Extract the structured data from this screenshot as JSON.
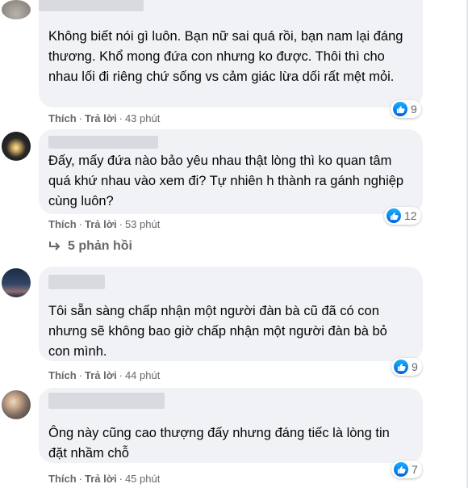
{
  "comments": [
    {
      "text": "Không biết nói gì luôn. Bạn nữ sai quá rồi, bạn nam lại đáng thương. Khổ mong đứa con nhưng ko được. Thôi thì cho nhau lối đi riêng chứ sống vs cảm giác lừa dối rất mệt mỏi.",
      "like_label": "Thích",
      "reply_label": "Trả lời",
      "time": "43 phút",
      "reaction_count": "9"
    },
    {
      "text": "Đấy, mấy đứa nào bảo yêu nhau thật lòng thì ko quan tâm quá khứ nhau vào xem đi? Tự nhiên h thành ra gánh nghiệp cùng luôn?",
      "like_label": "Thích",
      "reply_label": "Trả lời",
      "time": "53 phút",
      "reaction_count": "12"
    },
    {
      "text": "Tôi sẵn sàng chấp nhận một người đàn bà cũ đã có con nhưng sẽ không bao giờ chấp nhận một người đàn bà bỏ con mình.",
      "like_label": "Thích",
      "reply_label": "Trả lời",
      "time": "44 phút",
      "reaction_count": "9"
    },
    {
      "text": "Ông này cũng cao thượng đấy nhưng đáng tiếc là lòng tin đặt nhầm chỗ",
      "like_label": "Thích",
      "reply_label": "Trả lời",
      "time": "45 phút",
      "reaction_count": "7"
    }
  ],
  "replies_label": "5 phản hồi",
  "colors": {
    "bubble": "#f0f2f5",
    "meta_text": "#65676b",
    "like_blue": "#1877f2"
  }
}
